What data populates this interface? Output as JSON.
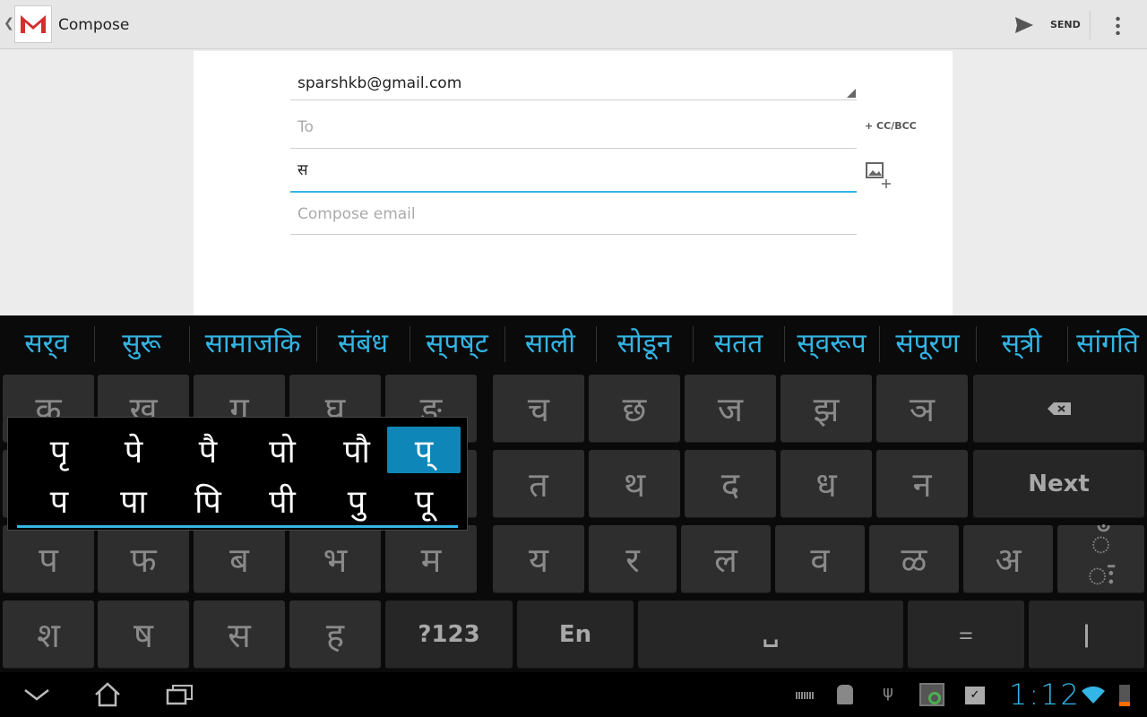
{
  "actionbar": {
    "title": "Compose",
    "send_label": "SEND",
    "icons": [
      "gmail-logo",
      "send-icon",
      "overflow-menu-icon"
    ]
  },
  "form": {
    "from": "sparshkb@gmail.com",
    "to_placeholder": "To",
    "cc_bcc": "+ CC/BCC",
    "subject": "स",
    "body_placeholder": "Compose email"
  },
  "suggestions": [
    "सर्‌व",
    "सुरू",
    "सामाजकि",
    "संबंध",
    "स्‌पष्‌ट",
    "साली",
    "सोडून",
    "सतत",
    "स्‌वरूप",
    "संपूरण",
    "स्‌त्री",
    "सांगति"
  ],
  "keys": {
    "row1_left": [
      "क",
      "ख",
      "ग",
      "घ",
      "ङ"
    ],
    "row1_right": [
      "च",
      "छ",
      "ज",
      "झ",
      "ञ"
    ],
    "row2_right": [
      "त",
      "थ",
      "द",
      "ध",
      "न"
    ],
    "next": "Next",
    "row3_left": [
      "प",
      "फ",
      "ब",
      "भ",
      "म"
    ],
    "row3_right": [
      "य",
      "र",
      "ल",
      "व",
      "ळ",
      "अ"
    ],
    "candrabindu": "ँ",
    "visarga": "ः",
    "row4_left": [
      "श",
      "ष",
      "स",
      "ह"
    ],
    "symbols": "?123",
    "lang": "En",
    "space": "␣",
    "danda": "|"
  },
  "popup": {
    "row1": [
      "पृ",
      "पे",
      "पै",
      "पो",
      "पौ",
      "प्"
    ],
    "row2": [
      "प",
      "पा",
      "पि",
      "पी",
      "पु",
      "पू"
    ],
    "selected": "प्"
  },
  "accent": "#33b5e5",
  "status": {
    "time": "1:12"
  }
}
